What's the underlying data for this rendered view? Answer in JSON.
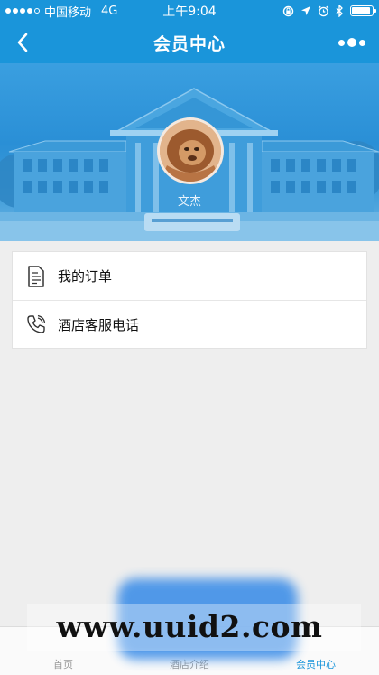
{
  "status_bar": {
    "carrier": "中国移动",
    "network": "4G",
    "time": "上午9:04",
    "battery_level": 0.9
  },
  "nav": {
    "title": "会员中心",
    "back_icon": "chevron-left-icon",
    "more_icon": "more-dots-icon"
  },
  "profile": {
    "username": "文杰"
  },
  "menu": {
    "items": [
      {
        "label": "我的订单",
        "icon": "document-icon"
      },
      {
        "label": "酒店客服电话",
        "icon": "phone-icon"
      }
    ]
  },
  "tabs": [
    {
      "label": "首页",
      "active": false
    },
    {
      "label": "酒店介绍",
      "active": false
    },
    {
      "label": "会员中心",
      "active": true
    }
  ],
  "watermark": "www.uuid2.com",
  "colors": {
    "primary": "#1a95da",
    "background": "#eeeeee"
  }
}
